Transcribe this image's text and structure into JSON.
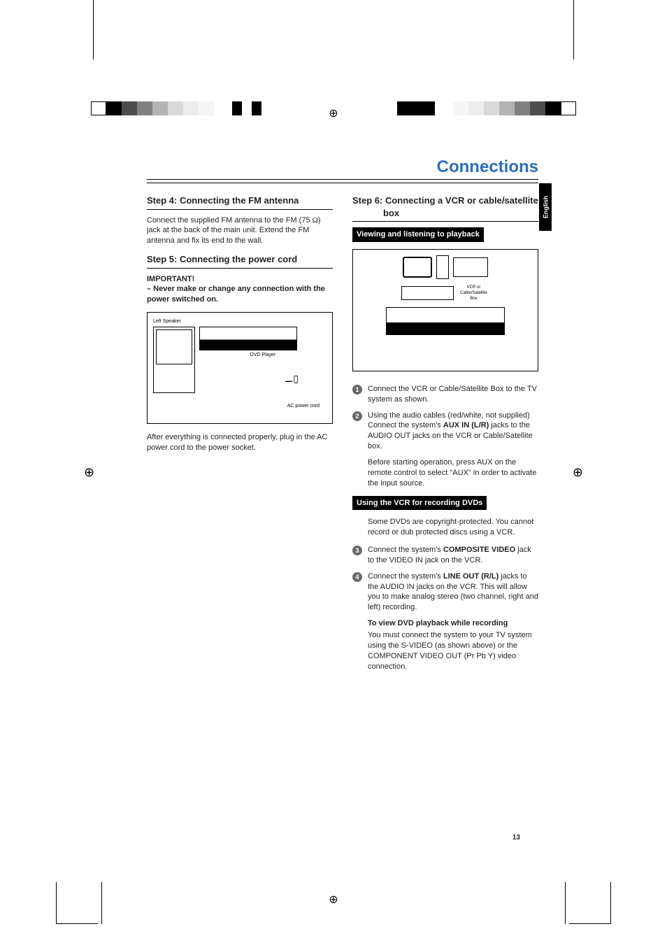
{
  "page": {
    "title": "Connections",
    "language_tab": "English",
    "page_number": "13"
  },
  "left_column": {
    "step4_heading": "Step 4: Connecting the FM antenna",
    "step4_body_a": "Connect the supplied FM antenna to the FM (75 ",
    "step4_omega": "Ω",
    "step4_body_b": ") jack at the back of the main unit. Extend the FM antenna and fix its end to the wall.",
    "step5_heading": "Step 5:  Connecting the power cord",
    "important_heading": "IMPORTANT!",
    "important_body": "–   Never make or change any connection with the power switched on.",
    "fig1_left_speaker": "Left Speaker",
    "fig1_dvd_label": "DVD Player",
    "fig1_ac_label": "AC power cord",
    "after_connect": "After everything is connected properly, plug in the AC power cord to the power socket."
  },
  "right_column": {
    "step6_heading": "Step 6:  Connecting a VCR or cable/satellite box",
    "sub1": "Viewing and listening to playback",
    "fig2_vcr_label": "VCR or Cable/Satellite Box",
    "s1": "Connect the VCR or Cable/Satellite Box to the TV system as shown.",
    "s2_a": "Using the audio cables (red/white, not supplied) Connect the system's ",
    "s2_b": "AUX IN (L/R)",
    "s2_c": " jacks to the AUDIO OUT jacks on the VCR or Cable/Satellite box.",
    "indent1_a": "Before starting operation, press ",
    "indent1_b": "AUX",
    "indent1_c": " on the remote control to select \"AUX\" in order to activate the input source.",
    "sub2": "Using the VCR for recording DVDs",
    "copy_protect": "Some DVDs are copyright-protected. You cannot record or dub protected discs using a VCR.",
    "s3_a": "Connect the system's ",
    "s3_b": "COMPOSITE VIDEO",
    "s3_c": " jack to the VIDEO IN jack on the VCR.",
    "s4_a": "Connect the system's ",
    "s4_b": "LINE OUT (R/L)",
    "s4_c": " jacks to the AUDIO IN jacks on the VCR.  This will allow you to make analog stereo (two channel, right and left) recording.",
    "view_head": "To view DVD playback while recording",
    "view_body_a": "You must connect the system to your TV system using the ",
    "view_body_b": "S-VIDEO",
    "view_body_c": " (as shown above) or the ",
    "view_body_d": "COMPONENT VIDEO OUT",
    "view_body_e": " (Pr Pb Y) video connection."
  }
}
